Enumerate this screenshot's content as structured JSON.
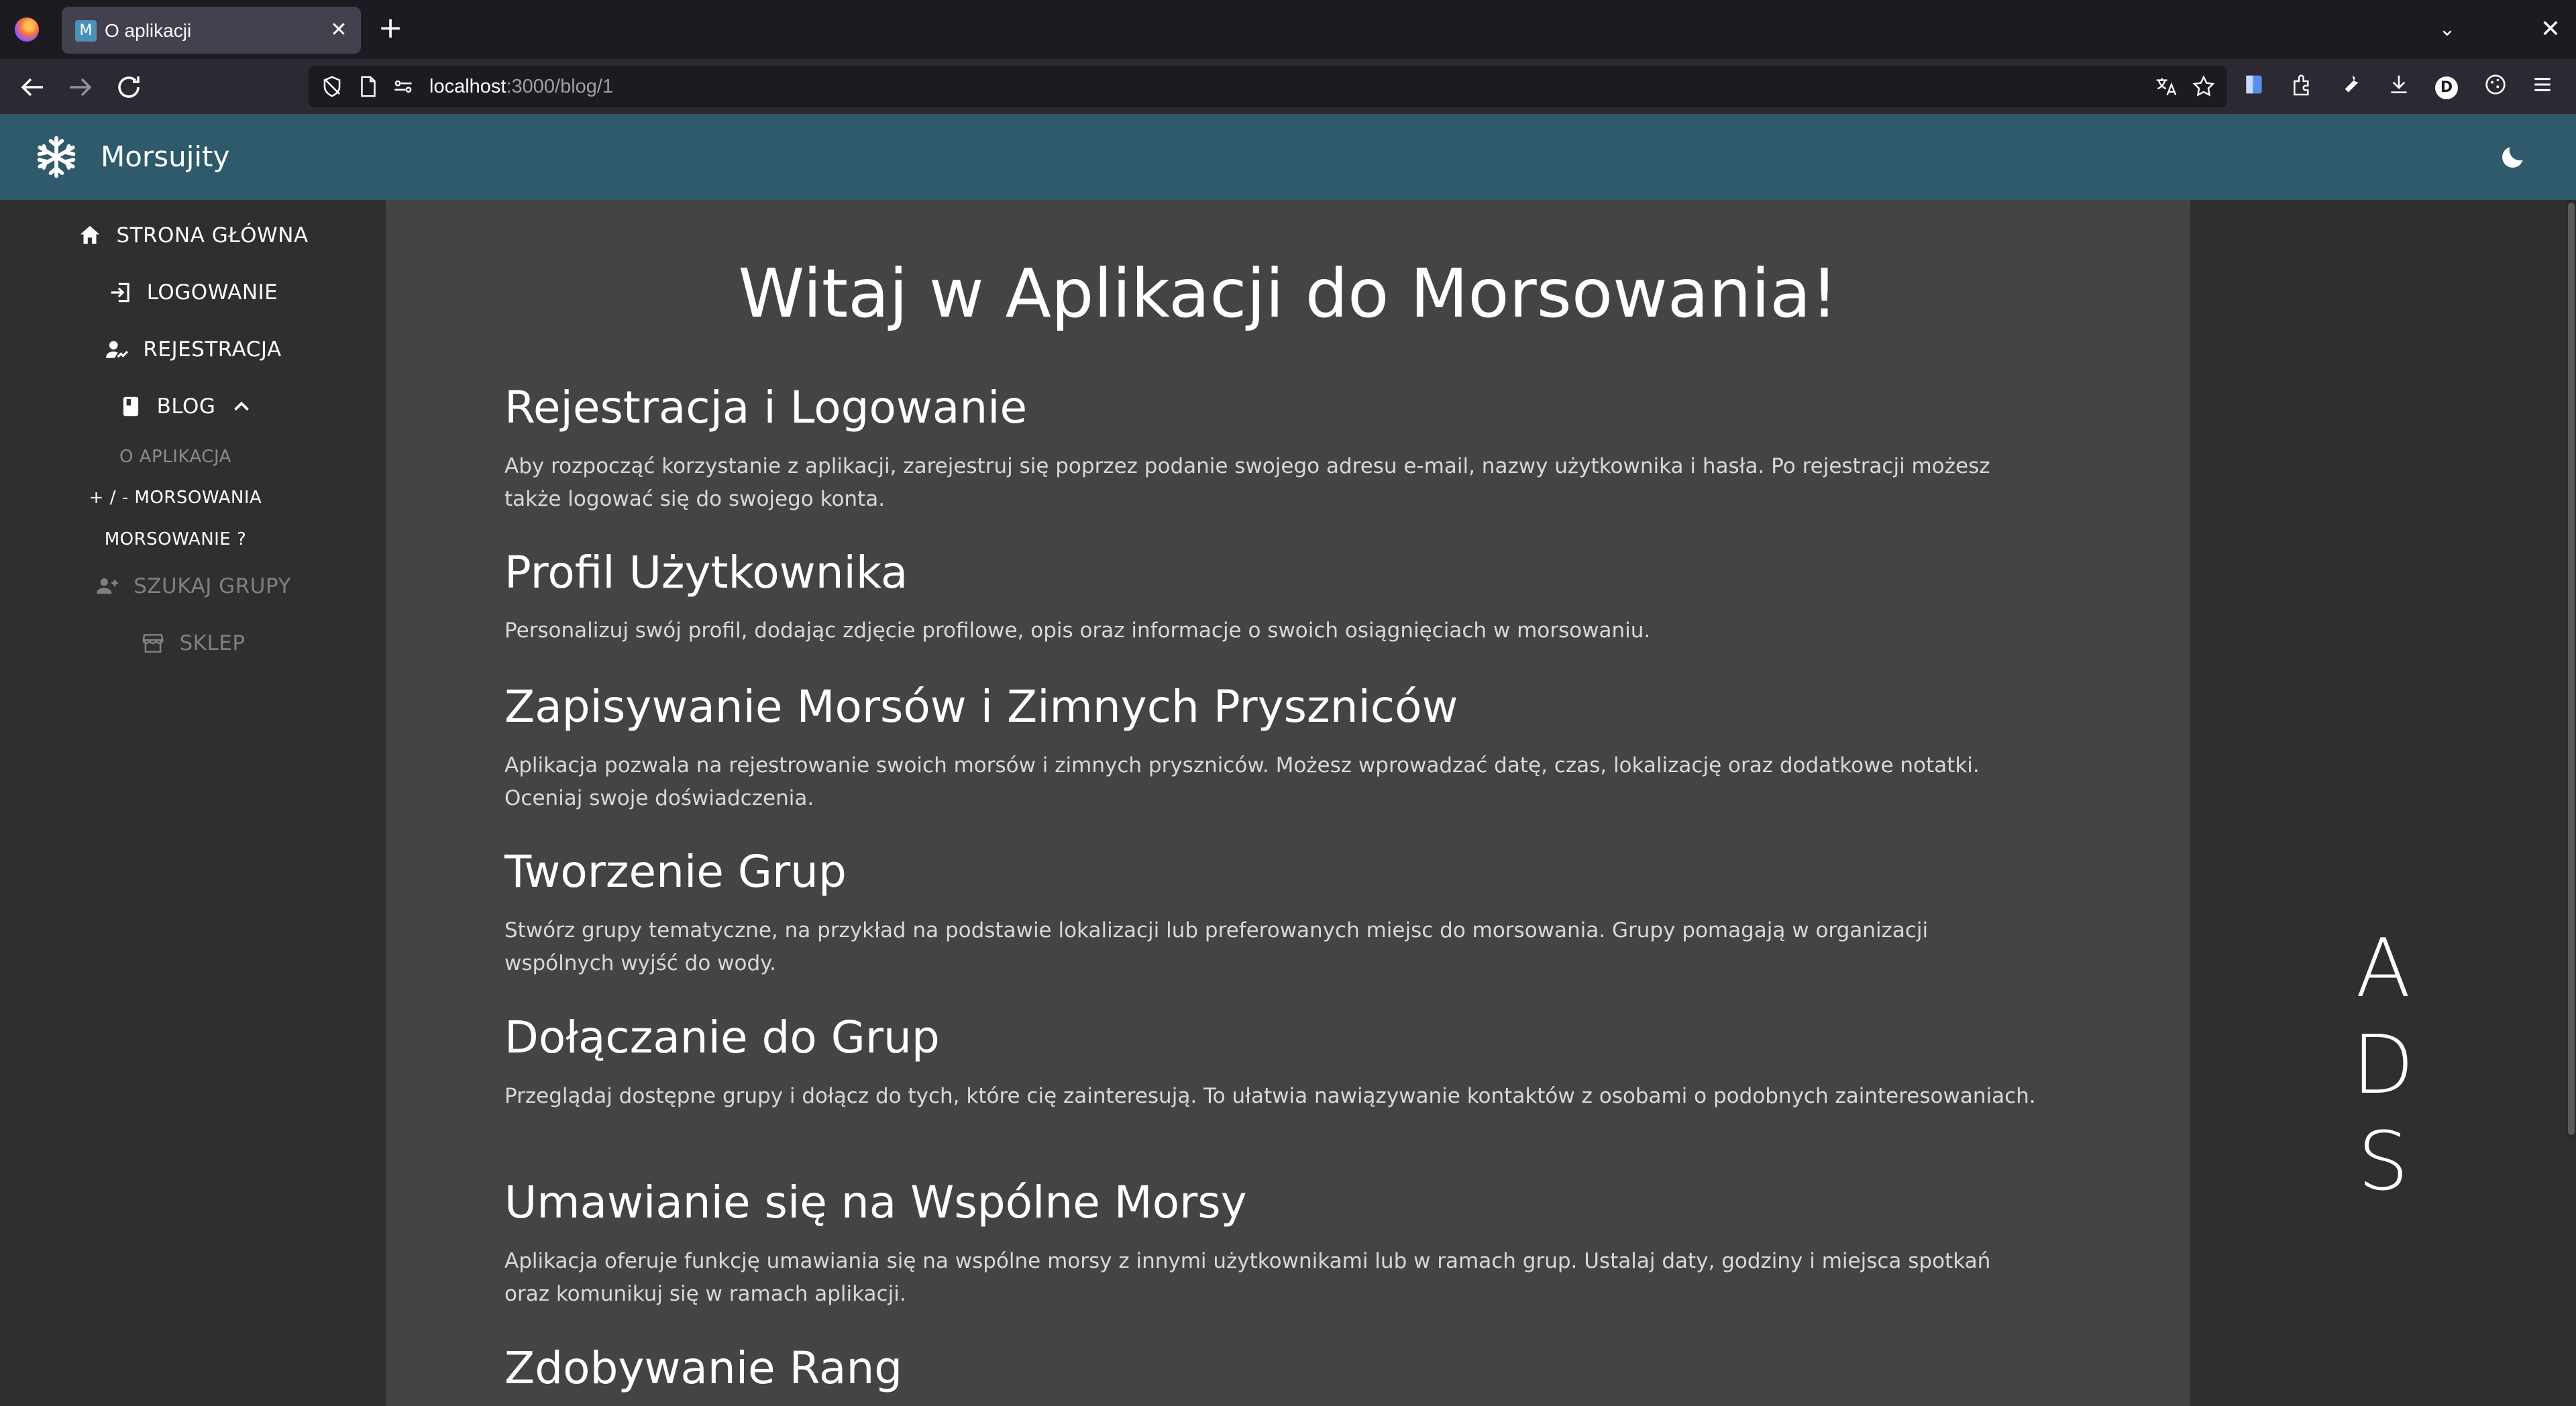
{
  "browser": {
    "tab": {
      "favicon": "M",
      "title": "O aplikacji",
      "close_icon": "close-icon"
    },
    "new_tab_label": "+",
    "url": {
      "host": "localhost",
      "path": ":3000/blog/1"
    },
    "account_initial": "D"
  },
  "app": {
    "name": "Morsujity",
    "accent_color": "#2e5a6b",
    "logo_icon": "snowflake-icon",
    "theme_toggle_icon": "moon-icon"
  },
  "sidebar": {
    "items": [
      {
        "label": "STRONA GŁÓWNA",
        "icon": "home-icon"
      },
      {
        "label": "LOGOWANIE",
        "icon": "login-icon"
      },
      {
        "label": "REJESTRACJA",
        "icon": "register-icon"
      },
      {
        "label": "BLOG",
        "icon": "book-icon",
        "expanded": true
      }
    ],
    "blog_subitems": [
      {
        "label": "O APLIKACJA",
        "active": true
      },
      {
        "label": "+ / - MORSOWANIA"
      },
      {
        "label": "MORSOWANIE ?"
      }
    ],
    "disabled_items": [
      {
        "label": "SZUKAJ GRUPY",
        "icon": "group-add-icon"
      },
      {
        "label": "SKLEP",
        "icon": "store-icon"
      }
    ]
  },
  "main": {
    "title": "Witaj w Aplikacji do Morsowania!",
    "sections": [
      {
        "heading": "Rejestracja i Logowanie",
        "text": "Aby rozpocząć korzystanie z aplikacji, zarejestruj się poprzez podanie swojego adresu e-mail, nazwy użytkownika i hasła. Po rejestracji możesz także logować się do swojego konta."
      },
      {
        "heading": "Profil Użytkownika",
        "text": "Personalizuj swój profil, dodając zdjęcie profilowe, opis oraz informacje o swoich osiągnięciach w morsowaniu."
      },
      {
        "heading": "Zapisywanie Morsów i Zimnych Pryszniców",
        "text": "Aplikacja pozwala na rejestrowanie swoich morsów i zimnych pryszniców. Możesz wprowadzać datę, czas, lokalizację oraz dodatkowe notatki. Oceniaj swoje doświadczenia."
      },
      {
        "heading": "Tworzenie Grup",
        "text": "Stwórz grupy tematyczne, na przykład na podstawie lokalizacji lub preferowanych miejsc do morsowania. Grupy pomagają w organizacji wspólnych wyjść do wody."
      },
      {
        "heading": "Dołączanie do Grup",
        "text": "Przeglądaj dostępne grupy i dołącz do tych, które cię zainteresują. To ułatwia nawiązywanie kontaktów z osobami o podobnych zainteresowaniach."
      },
      {
        "heading": "Umawianie się na Wspólne Morsy",
        "text": "Aplikacja oferuje funkcję umawiania się na wspólne morsy z innymi użytkownikami lub w ramach grup. Ustalaj daty, godziny i miejsca spotkań oraz komunikuj się w ramach aplikacji."
      },
      {
        "heading": "Zdobywanie Rang",
        "text": ""
      }
    ]
  },
  "ads": {
    "letters": [
      "A",
      "D",
      "S"
    ]
  }
}
